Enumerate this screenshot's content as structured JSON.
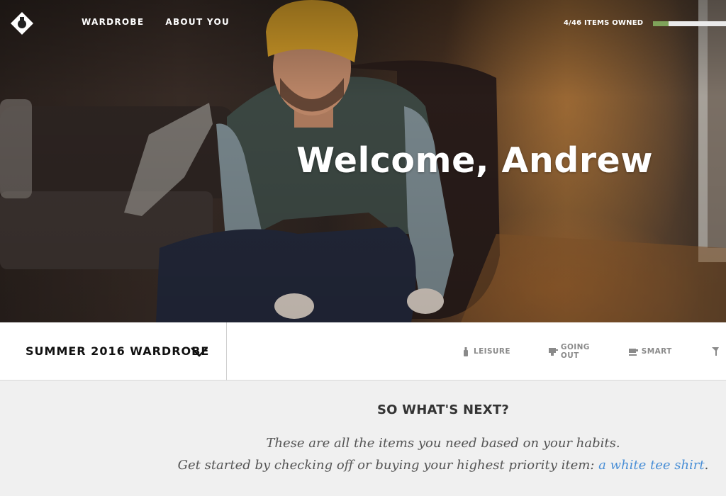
{
  "nav": {
    "items": [
      {
        "label": "WARDROBE"
      },
      {
        "label": "ABOUT YOU"
      }
    ]
  },
  "progress": {
    "owned_label": "4/46 ITEMS OWNED",
    "owned": 4,
    "total": 46,
    "fill_color": "#7fa35a"
  },
  "hero": {
    "welcome": "Welcome, Andrew"
  },
  "wardrobe_bar": {
    "season": "SUMMER 2016 WARDROBE",
    "categories": [
      {
        "label": "LEISURE",
        "icon": "bottle-icon"
      },
      {
        "label": "GOING OUT",
        "icon": "cocktail-icon"
      },
      {
        "label": "SMART",
        "icon": "coffee-icon"
      }
    ]
  },
  "next": {
    "heading": "SO WHAT'S NEXT?",
    "line1": "These are all the items you need based on your habits.",
    "line2_prefix": "Get started by checking off or buying your highest priority item: ",
    "line2_link": "a white tee shirt",
    "line2_suffix": "."
  },
  "colors": {
    "link": "#4a8fd6",
    "progress_fill": "#7fa35a",
    "bar_bg": "#ffffff",
    "page_bg": "#f0f0f0"
  }
}
